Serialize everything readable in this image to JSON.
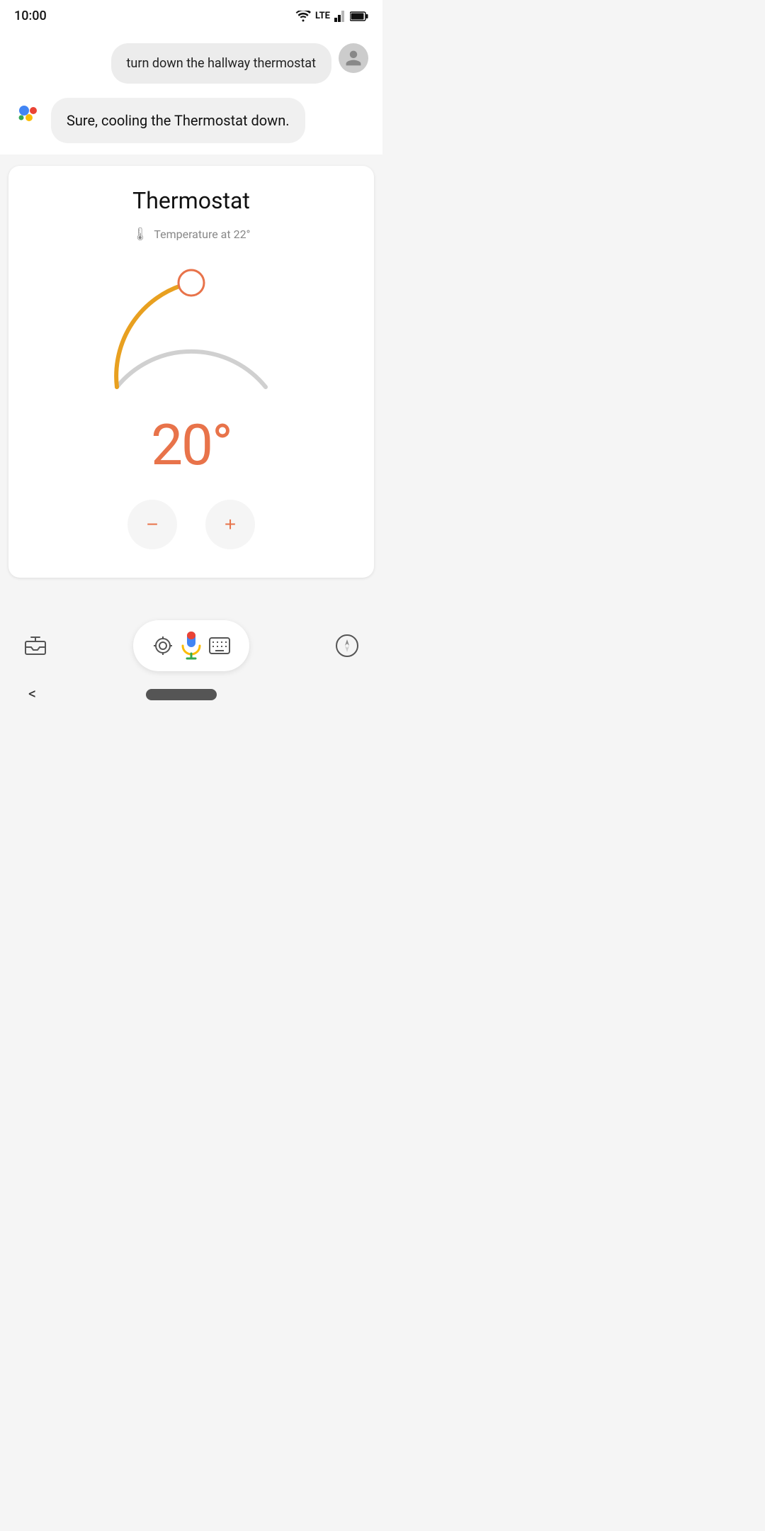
{
  "status_bar": {
    "time": "10:00",
    "lte_label": "LTE"
  },
  "user_message": {
    "text": "turn down the hallway thermostat"
  },
  "assistant_message": {
    "text": "Sure, cooling the Thermostat down."
  },
  "thermostat_card": {
    "title": "Thermostat",
    "temperature_label": "Temperature at 22°",
    "current_temp": "20°",
    "decrease_label": "−",
    "increase_label": "+"
  },
  "colors": {
    "dial_active": "#E8A020",
    "dial_inactive": "#D0D0D0",
    "dial_handle": "#E8734A",
    "temp_color": "#E8734A"
  },
  "nav": {
    "back_label": "<"
  }
}
